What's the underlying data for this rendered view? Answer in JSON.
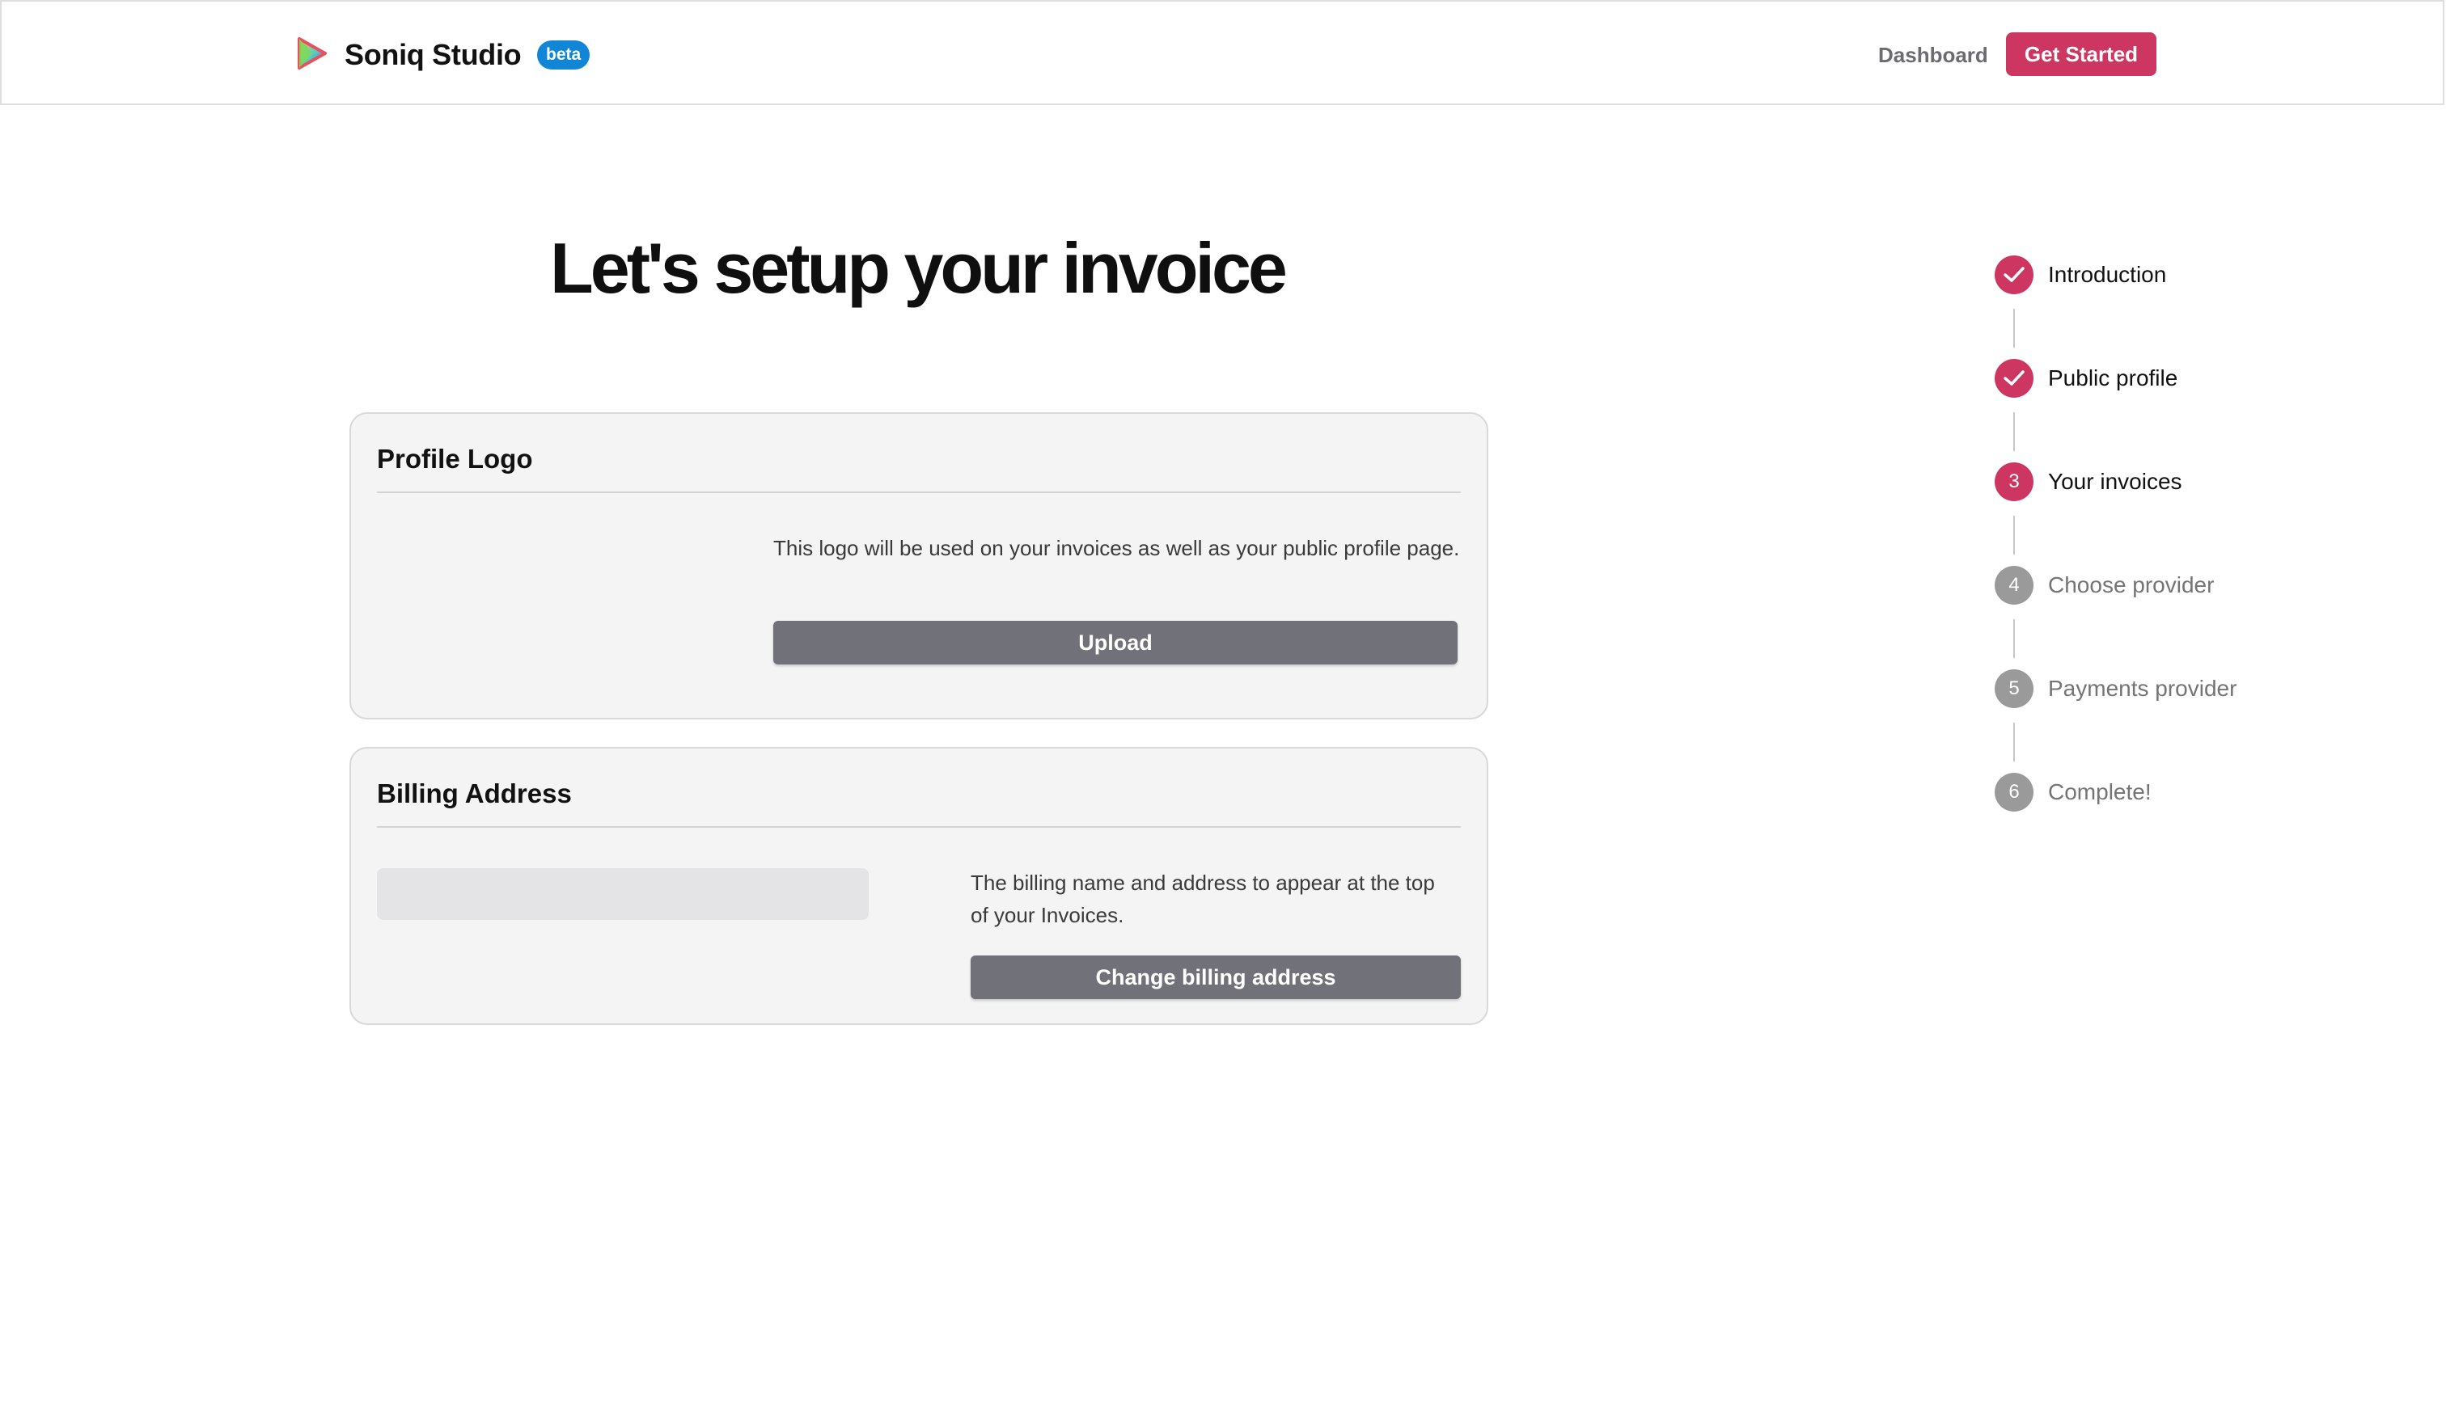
{
  "header": {
    "brand_name": "Soniq Studio",
    "badge": "beta",
    "nav_dashboard": "Dashboard",
    "cta_label": "Get Started",
    "colors": {
      "accent": "#cc3660",
      "badge": "#1286d6"
    }
  },
  "main": {
    "title": "Let's setup your invoice",
    "profile_logo": {
      "title": "Profile Logo",
      "description": "This logo will be used on your invoices as well as your public profile page.",
      "button_label": "Upload"
    },
    "billing_address": {
      "title": "Billing Address",
      "description": "The billing name and address to appear at the top of your Invoices.",
      "button_label": "Change billing address"
    }
  },
  "stepper": {
    "steps": [
      {
        "label": "Introduction",
        "state": "completed",
        "icon": "check-icon"
      },
      {
        "label": "Public profile",
        "state": "completed",
        "icon": "check-icon"
      },
      {
        "label": "Your invoices",
        "state": "current",
        "number": "3"
      },
      {
        "label": "Choose provider",
        "state": "pending",
        "number": "4"
      },
      {
        "label": "Payments provider",
        "state": "pending",
        "number": "5"
      },
      {
        "label": "Complete!",
        "state": "pending",
        "number": "6"
      }
    ]
  }
}
